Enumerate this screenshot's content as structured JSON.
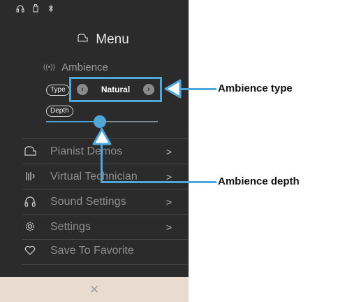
{
  "status_icons": [
    "headphones-icon",
    "usb-icon",
    "bluetooth-icon"
  ],
  "menu": {
    "title": "Menu"
  },
  "ambience": {
    "heading": "Ambience",
    "type_label": "Type",
    "type_value": "Natural",
    "depth_label": "Depth",
    "depth_level": 0.48
  },
  "items": [
    {
      "label": "Pianist Demos",
      "chevron": ">"
    },
    {
      "label": "Virtual Technician",
      "chevron": ">"
    },
    {
      "label": "Sound Settings",
      "chevron": ">"
    },
    {
      "label": "Settings",
      "chevron": ">"
    },
    {
      "label": "Save To Favorite"
    }
  ],
  "close_symbol": "×",
  "callouts": {
    "type": "Ambience type",
    "depth": "Ambience depth"
  },
  "colors": {
    "accent": "#4fa6d8",
    "background": "#2b2b2b",
    "close_bar": "#eadbd0"
  }
}
